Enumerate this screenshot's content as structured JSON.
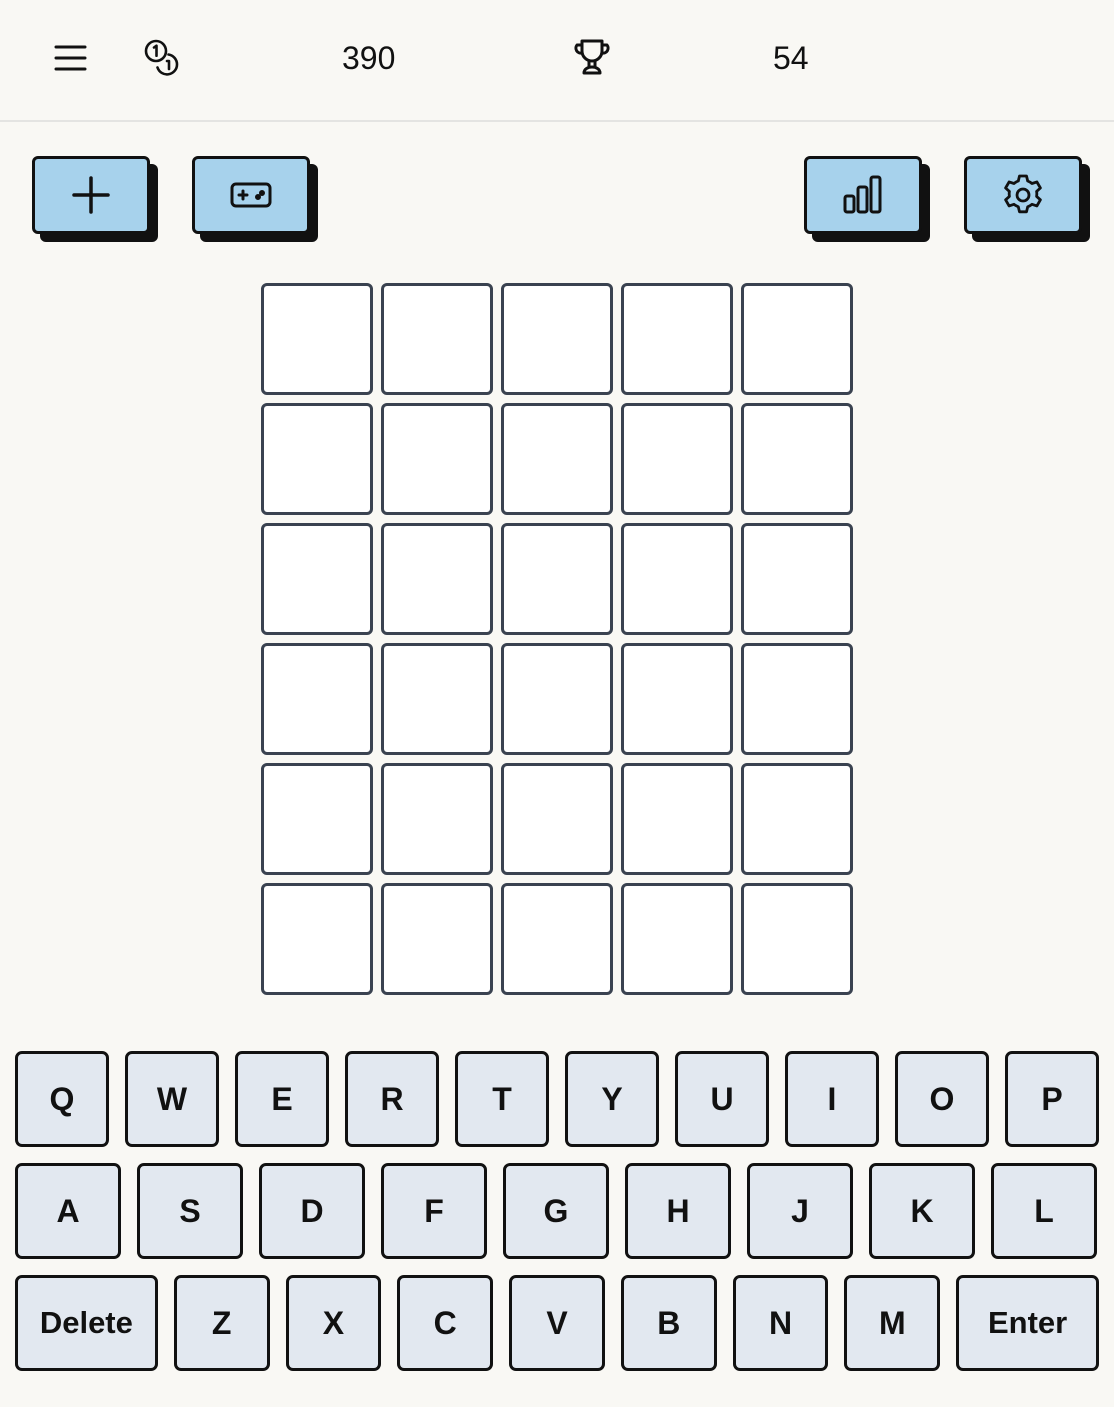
{
  "header": {
    "coins": "390",
    "streak": "54",
    "icons": [
      "menu-icon",
      "coins-icon",
      "trophy-icon"
    ]
  },
  "actions": {
    "icons": [
      "plus-icon",
      "gamepad-icon",
      "stats-icon",
      "gear-icon"
    ]
  },
  "board": {
    "rows": 6,
    "cols": 5,
    "cells": [
      [
        "",
        "",
        "",
        "",
        ""
      ],
      [
        "",
        "",
        "",
        "",
        ""
      ],
      [
        "",
        "",
        "",
        "",
        ""
      ],
      [
        "",
        "",
        "",
        "",
        ""
      ],
      [
        "",
        "",
        "",
        "",
        ""
      ],
      [
        "",
        "",
        "",
        "",
        ""
      ]
    ]
  },
  "keyboard": {
    "row1": [
      "Q",
      "W",
      "E",
      "R",
      "T",
      "Y",
      "U",
      "I",
      "O",
      "P"
    ],
    "row2": [
      "A",
      "S",
      "D",
      "F",
      "G",
      "H",
      "J",
      "K",
      "L"
    ],
    "row3": [
      "Delete",
      "Z",
      "X",
      "C",
      "V",
      "B",
      "N",
      "M",
      "Enter"
    ]
  },
  "colors": {
    "background": "#f9f8f4",
    "button": "#a7d2ec",
    "key": "#e2e8f0",
    "tile_border": "#3a4250"
  }
}
